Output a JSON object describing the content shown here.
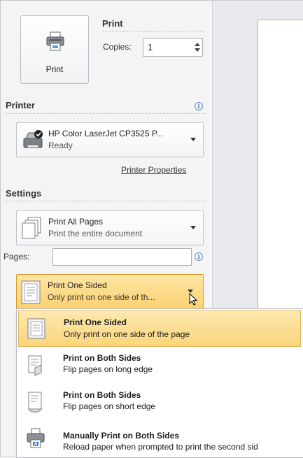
{
  "print_button": {
    "label": "Print"
  },
  "print_section": {
    "title": "Print",
    "copies_label": "Copies:",
    "copies_value": "1"
  },
  "printer_section": {
    "title": "Printer",
    "selected_printer": {
      "name": "HP Color LaserJet CP3525 P...",
      "status": "Ready"
    },
    "properties_link": "Printer Properties"
  },
  "settings_section": {
    "title": "Settings",
    "pages_dropdown": {
      "title": "Print All Pages",
      "subtitle": "Print the entire document"
    },
    "pages_label": "Pages:",
    "pages_value": "",
    "sided_dropdown": {
      "title": "Print One Sided",
      "subtitle": "Only print on one side of th..."
    }
  },
  "sided_menu": {
    "items": [
      {
        "title": "Print One Sided",
        "subtitle": "Only print on one side of the page",
        "icon": "one-sided-page-icon",
        "selected": true
      },
      {
        "title": "Print on Both Sides",
        "subtitle": "Flip pages on long edge",
        "icon": "duplex-long-edge-icon",
        "selected": false
      },
      {
        "title": "Print on Both Sides",
        "subtitle": "Flip pages on short edge",
        "icon": "duplex-short-edge-icon",
        "selected": false
      },
      {
        "title": "Manually Print on Both Sides",
        "subtitle": "Reload paper when prompted to print the second sid",
        "icon": "manual-duplex-printer-icon",
        "selected": false
      }
    ]
  },
  "colors": {
    "highlight": "#fbd06f",
    "highlight_border": "#d79a2b",
    "pane_bg": "#f4f4f5",
    "info_blue": "#3b6fbf"
  }
}
